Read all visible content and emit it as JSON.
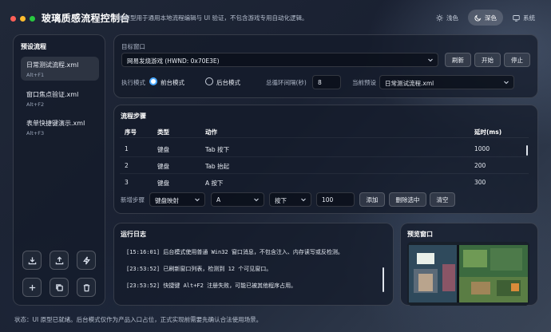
{
  "app": {
    "title": "玻璃质感流程控制台",
    "subtitle": "本原型用于通用本地流程编辑与 UI 验证，不包含游戏专用自动化逻辑。",
    "window_dots": [
      "#ff5f57",
      "#febc2e",
      "#28c840"
    ]
  },
  "theme": {
    "light_label": "浅色",
    "dark_label": "深色",
    "system_label": "系统",
    "selected": "深色"
  },
  "sidebar": {
    "title": "预设流程",
    "presets": [
      {
        "name": "日常测试流程.xml",
        "hotkey": "Alt+F1"
      },
      {
        "name": "窗口焦点验证.xml",
        "hotkey": "Alt+F2"
      },
      {
        "name": "表单快捷键演示.xml",
        "hotkey": "Alt+F3"
      }
    ],
    "tool_icons": [
      "import-icon",
      "export-icon",
      "lightning-icon",
      "add-icon",
      "copy-icon",
      "trash-icon"
    ]
  },
  "target": {
    "label": "目标窗口",
    "window_value": "网易发烧游戏 (HWND: 0x70E3E)",
    "refresh_label": "刷新",
    "start_label": "开始",
    "stop_label": "停止",
    "mode_label": "执行模式",
    "mode_foreground": "前台模式",
    "mode_background": "后台模式",
    "loop_label": "总循环间隔(秒)",
    "loop_value": "8",
    "current_preset_label": "当前预设",
    "current_preset_value": "日常测试流程.xml",
    "accent": "#4aa8ff"
  },
  "steps": {
    "title": "流程步骤",
    "columns": [
      "序号",
      "类型",
      "动作",
      "延时(ms)"
    ],
    "rows": [
      {
        "index": "1",
        "type": "键盘",
        "action": "Tab 按下",
        "delay": "1000"
      },
      {
        "index": "2",
        "type": "键盘",
        "action": "Tab 抬起",
        "delay": "200"
      },
      {
        "index": "3",
        "type": "键盘",
        "action": "A 按下",
        "delay": "300"
      }
    ],
    "add_label": "新增步骤",
    "add_type": "键盘映射",
    "add_key": "A",
    "add_action": "按下",
    "add_delay": "100",
    "add_button": "添加",
    "delete_button": "删除选中",
    "clear_button": "清空"
  },
  "log": {
    "title": "运行日志",
    "lines": [
      "[15:16:01] 后台模式使用普通 Win32 窗口消息，不包含注入、内存读写或反检测。",
      "[23:53:52] 已刷新窗口列表，检测到 12 个可见窗口。",
      "[23:53:52] 快捷键 Alt+F2 注册失败，可能已被其他程序占用。"
    ]
  },
  "preview": {
    "title": "预览窗口"
  },
  "status": {
    "text": "状态：UI 原型已就绪。后台模式仅作为产品入口占位，正式实现前需要先确认合法使用场景。"
  }
}
